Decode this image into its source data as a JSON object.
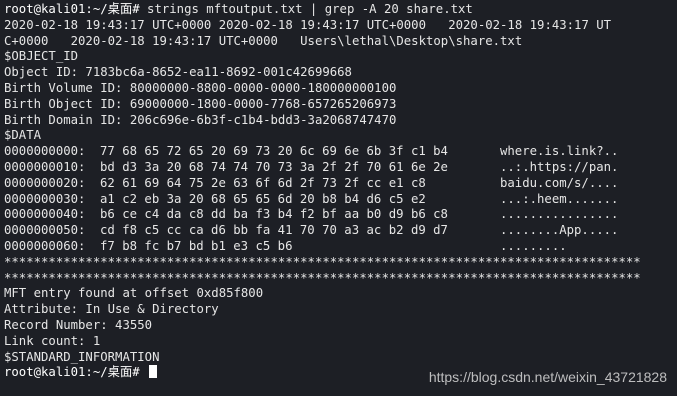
{
  "terminal": {
    "prompt": "root@kali01:~/桌面#",
    "command": " strings mftoutput.txt | grep -A 20 share.txt",
    "output_line_1": "2020-02-18 19:43:17 UTC+0000 2020-02-18 19:43:17 UTC+0000   2020-02-18 19:43:17 UT",
    "output_line_2": "C+0000   2020-02-18 19:43:17 UTC+0000   Users\\lethal\\Desktop\\share.txt",
    "object_id_header": "$OBJECT_ID",
    "object_id": "Object ID: 7183bc6a-8652-ea11-8692-001c42699668",
    "birth_volume_id": "Birth Volume ID: 80000000-8800-0000-0000-180000000100",
    "birth_object_id": "Birth Object ID: 69000000-1800-0000-7768-657265206973",
    "birth_domain_id": "Birth Domain ID: 206c696e-6b3f-c1b4-bdd3-3a2068747470",
    "data_header": "$DATA",
    "hex_rows": [
      {
        "offset": "0000000000:",
        "bytes": "77 68 65 72 65 20 69 73 20 6c 69 6e 6b 3f c1 b4",
        "ascii": "where.is.link?.."
      },
      {
        "offset": "0000000010:",
        "bytes": "bd d3 3a 20 68 74 74 70 73 3a 2f 2f 70 61 6e 2e",
        "ascii": "..:.https://pan."
      },
      {
        "offset": "0000000020:",
        "bytes": "62 61 69 64 75 2e 63 6f 6d 2f 73 2f cc e1 c8",
        "ascii": "baidu.com/s/...."
      },
      {
        "offset": "0000000030:",
        "bytes": "a1 c2 eb 3a 20 68 65 65 6d 20 b8 b4 d6 c5 e2",
        "ascii": "...:.heem......."
      },
      {
        "offset": "0000000040:",
        "bytes": "b6 ce c4 da c8 dd ba f3 b4 f2 bf aa b0 d9 b6 c8",
        "ascii": "................"
      },
      {
        "offset": "0000000050:",
        "bytes": "cd f8 c5 cc ca d6 bb fa 41 70 70 a3 ac b2 d9 d7",
        "ascii": "........App....."
      },
      {
        "offset": "0000000060:",
        "bytes": "f7 b8 fc b7 bd b1 e3 c5 b6",
        "ascii": "........."
      }
    ],
    "separator_1": "**************************************************************************************",
    "separator_2": "**************************************************************************************",
    "mft_entry": "MFT entry found at offset 0xd85f800",
    "attribute": "Attribute: In Use & Directory",
    "record_number": "Record Number: 43550",
    "link_count": "Link count: 1",
    "standard_info_header": "$STANDARD_INFORMATION",
    "final_prompt": "root@kali01:~/桌面# "
  },
  "watermark": "https://blog.csdn.net/weixin_43721828"
}
